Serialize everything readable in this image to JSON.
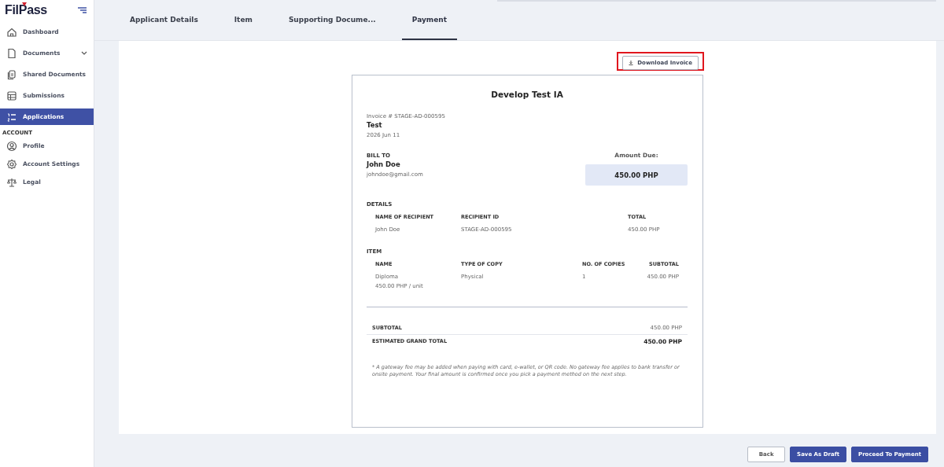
{
  "sidebar": {
    "logo": "FilPass",
    "items": [
      {
        "label": "Dashboard",
        "selected": false,
        "has_caret": false
      },
      {
        "label": "Documents",
        "selected": false,
        "has_caret": true
      },
      {
        "label": "Shared Documents",
        "selected": false,
        "has_caret": false
      },
      {
        "label": "Submissions",
        "selected": false,
        "has_caret": false
      },
      {
        "label": "Applications",
        "selected": true,
        "has_caret": false
      }
    ],
    "section_title": "ACCOUNT",
    "account_items": [
      {
        "label": "Profile",
        "selected": false
      },
      {
        "label": "Account Settings",
        "selected": false
      },
      {
        "label": "Legal",
        "selected": false
      }
    ]
  },
  "tabs": [
    {
      "label": "Applicant Details",
      "selected": false
    },
    {
      "label": "Item",
      "selected": false
    },
    {
      "label": "Supporting Docume...",
      "selected": false
    },
    {
      "label": "Payment",
      "selected": true
    }
  ],
  "download_button": {
    "label": "Download Invoice",
    "highlighted": true
  },
  "invoice": {
    "title": "Develop Test IA",
    "number": "Invoice # STAGE-AD-000595",
    "name": "Test",
    "date": "2026 Jun 11",
    "bill_to_label": "BILL TO",
    "bill_to_name": "John Doe",
    "bill_to_email": "johndoe@gmail.com",
    "amount_due_label": "Amount Due:",
    "amount_due": "450.00 PHP",
    "details": {
      "title": "DETAILS",
      "columns": [
        "NAME OF RECIPIENT",
        "RECIPIENT ID",
        "TOTAL"
      ],
      "rows": [
        [
          "John Doe",
          "STAGE-AD-000595",
          "450.00 PHP"
        ]
      ]
    },
    "item": {
      "title": "ITEM",
      "columns": [
        "NAME",
        "TYPE OF COPY",
        "NO. OF COPIES",
        "SUBTOTAL"
      ],
      "rows": [
        {
          "name": "Diploma",
          "unit_price": "450.00 PHP / unit",
          "type": "Physical",
          "copies": "1",
          "subtotal": "450.00 PHP"
        }
      ]
    },
    "totals": [
      {
        "label": "SUBTOTAL",
        "value": "450.00 PHP",
        "bold": false
      },
      {
        "label": "ESTIMATED GRAND TOTAL",
        "value": "450.00 PHP",
        "bold": true
      }
    ],
    "note": "* A gateway fee may be added when paying with card, e-wallet, or QR code. No gateway fee applies to bank transfer or onsite payment. Your final amount is confirmed once you pick a payment method on the next step."
  },
  "footer_buttons": [
    {
      "label": "Back",
      "kind": "secondary"
    },
    {
      "label": "Save As Draft",
      "kind": "primary"
    },
    {
      "label": "Proceed To Payment",
      "kind": "primary"
    }
  ]
}
